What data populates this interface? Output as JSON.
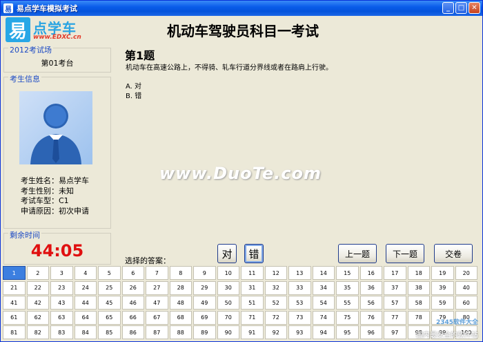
{
  "window": {
    "title": "易点学车模拟考试",
    "min_icon": "minimize-icon",
    "max_icon": "maximize-icon",
    "close_icon": "close-icon"
  },
  "header": {
    "logo_char": "易",
    "logo_name": "点学车",
    "logo_url": "www.EDXC.cn",
    "title": "机动车驾驶员科目一考试"
  },
  "venue": {
    "label": "2012考试场",
    "value": "第01考台"
  },
  "examinee": {
    "label": "考生信息",
    "name": "考生姓名：易点学车",
    "gender": "考生性别：未知",
    "vehicle": "考试车型：C1",
    "reason": "申请原因：初次申请"
  },
  "timer": {
    "label": "剩余时间",
    "value": "44:05"
  },
  "question": {
    "number": "第1题",
    "text": "机动车在高速公路上，不得骑、轧车行道分界线或者在路肩上行驶。",
    "option_a": "A. 对",
    "option_b": "B. 错"
  },
  "watermark": "www.DuoTe.com",
  "answer": {
    "label": "选择的答案：",
    "true_label": "对",
    "false_label": "错",
    "selected": "错"
  },
  "nav": {
    "prev": "上一题",
    "next": "下一题",
    "submit": "交卷"
  },
  "grid": {
    "total": 100,
    "current": 1
  },
  "corner": {
    "mark": "2345软件大全",
    "sub": "国内最安全的软件站"
  },
  "colors": {
    "accent": "#0453DB",
    "timer": "#E01010",
    "current_cell": "#3C7FE0"
  }
}
